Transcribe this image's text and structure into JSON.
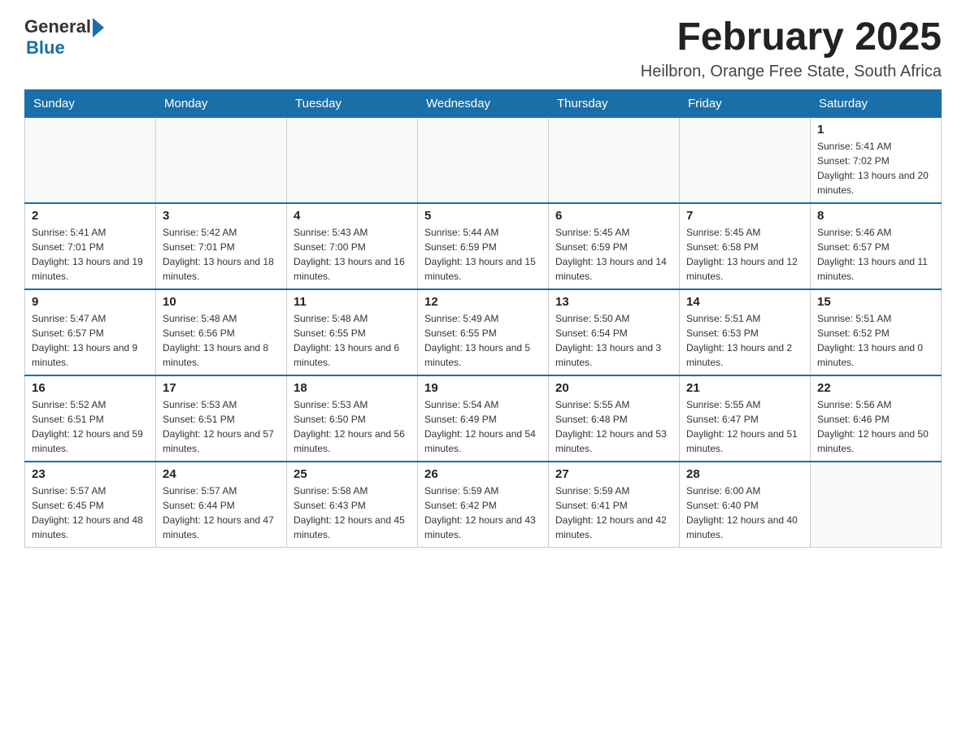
{
  "header": {
    "logo_general": "General",
    "logo_blue": "Blue",
    "month_title": "February 2025",
    "location": "Heilbron, Orange Free State, South Africa"
  },
  "weekdays": [
    "Sunday",
    "Monday",
    "Tuesday",
    "Wednesday",
    "Thursday",
    "Friday",
    "Saturday"
  ],
  "weeks": [
    [
      {
        "day": "",
        "sunrise": "",
        "sunset": "",
        "daylight": "",
        "empty": true
      },
      {
        "day": "",
        "sunrise": "",
        "sunset": "",
        "daylight": "",
        "empty": true
      },
      {
        "day": "",
        "sunrise": "",
        "sunset": "",
        "daylight": "",
        "empty": true
      },
      {
        "day": "",
        "sunrise": "",
        "sunset": "",
        "daylight": "",
        "empty": true
      },
      {
        "day": "",
        "sunrise": "",
        "sunset": "",
        "daylight": "",
        "empty": true
      },
      {
        "day": "",
        "sunrise": "",
        "sunset": "",
        "daylight": "",
        "empty": true
      },
      {
        "day": "1",
        "sunrise": "Sunrise: 5:41 AM",
        "sunset": "Sunset: 7:02 PM",
        "daylight": "Daylight: 13 hours and 20 minutes.",
        "empty": false
      }
    ],
    [
      {
        "day": "2",
        "sunrise": "Sunrise: 5:41 AM",
        "sunset": "Sunset: 7:01 PM",
        "daylight": "Daylight: 13 hours and 19 minutes.",
        "empty": false
      },
      {
        "day": "3",
        "sunrise": "Sunrise: 5:42 AM",
        "sunset": "Sunset: 7:01 PM",
        "daylight": "Daylight: 13 hours and 18 minutes.",
        "empty": false
      },
      {
        "day": "4",
        "sunrise": "Sunrise: 5:43 AM",
        "sunset": "Sunset: 7:00 PM",
        "daylight": "Daylight: 13 hours and 16 minutes.",
        "empty": false
      },
      {
        "day": "5",
        "sunrise": "Sunrise: 5:44 AM",
        "sunset": "Sunset: 6:59 PM",
        "daylight": "Daylight: 13 hours and 15 minutes.",
        "empty": false
      },
      {
        "day": "6",
        "sunrise": "Sunrise: 5:45 AM",
        "sunset": "Sunset: 6:59 PM",
        "daylight": "Daylight: 13 hours and 14 minutes.",
        "empty": false
      },
      {
        "day": "7",
        "sunrise": "Sunrise: 5:45 AM",
        "sunset": "Sunset: 6:58 PM",
        "daylight": "Daylight: 13 hours and 12 minutes.",
        "empty": false
      },
      {
        "day": "8",
        "sunrise": "Sunrise: 5:46 AM",
        "sunset": "Sunset: 6:57 PM",
        "daylight": "Daylight: 13 hours and 11 minutes.",
        "empty": false
      }
    ],
    [
      {
        "day": "9",
        "sunrise": "Sunrise: 5:47 AM",
        "sunset": "Sunset: 6:57 PM",
        "daylight": "Daylight: 13 hours and 9 minutes.",
        "empty": false
      },
      {
        "day": "10",
        "sunrise": "Sunrise: 5:48 AM",
        "sunset": "Sunset: 6:56 PM",
        "daylight": "Daylight: 13 hours and 8 minutes.",
        "empty": false
      },
      {
        "day": "11",
        "sunrise": "Sunrise: 5:48 AM",
        "sunset": "Sunset: 6:55 PM",
        "daylight": "Daylight: 13 hours and 6 minutes.",
        "empty": false
      },
      {
        "day": "12",
        "sunrise": "Sunrise: 5:49 AM",
        "sunset": "Sunset: 6:55 PM",
        "daylight": "Daylight: 13 hours and 5 minutes.",
        "empty": false
      },
      {
        "day": "13",
        "sunrise": "Sunrise: 5:50 AM",
        "sunset": "Sunset: 6:54 PM",
        "daylight": "Daylight: 13 hours and 3 minutes.",
        "empty": false
      },
      {
        "day": "14",
        "sunrise": "Sunrise: 5:51 AM",
        "sunset": "Sunset: 6:53 PM",
        "daylight": "Daylight: 13 hours and 2 minutes.",
        "empty": false
      },
      {
        "day": "15",
        "sunrise": "Sunrise: 5:51 AM",
        "sunset": "Sunset: 6:52 PM",
        "daylight": "Daylight: 13 hours and 0 minutes.",
        "empty": false
      }
    ],
    [
      {
        "day": "16",
        "sunrise": "Sunrise: 5:52 AM",
        "sunset": "Sunset: 6:51 PM",
        "daylight": "Daylight: 12 hours and 59 minutes.",
        "empty": false
      },
      {
        "day": "17",
        "sunrise": "Sunrise: 5:53 AM",
        "sunset": "Sunset: 6:51 PM",
        "daylight": "Daylight: 12 hours and 57 minutes.",
        "empty": false
      },
      {
        "day": "18",
        "sunrise": "Sunrise: 5:53 AM",
        "sunset": "Sunset: 6:50 PM",
        "daylight": "Daylight: 12 hours and 56 minutes.",
        "empty": false
      },
      {
        "day": "19",
        "sunrise": "Sunrise: 5:54 AM",
        "sunset": "Sunset: 6:49 PM",
        "daylight": "Daylight: 12 hours and 54 minutes.",
        "empty": false
      },
      {
        "day": "20",
        "sunrise": "Sunrise: 5:55 AM",
        "sunset": "Sunset: 6:48 PM",
        "daylight": "Daylight: 12 hours and 53 minutes.",
        "empty": false
      },
      {
        "day": "21",
        "sunrise": "Sunrise: 5:55 AM",
        "sunset": "Sunset: 6:47 PM",
        "daylight": "Daylight: 12 hours and 51 minutes.",
        "empty": false
      },
      {
        "day": "22",
        "sunrise": "Sunrise: 5:56 AM",
        "sunset": "Sunset: 6:46 PM",
        "daylight": "Daylight: 12 hours and 50 minutes.",
        "empty": false
      }
    ],
    [
      {
        "day": "23",
        "sunrise": "Sunrise: 5:57 AM",
        "sunset": "Sunset: 6:45 PM",
        "daylight": "Daylight: 12 hours and 48 minutes.",
        "empty": false
      },
      {
        "day": "24",
        "sunrise": "Sunrise: 5:57 AM",
        "sunset": "Sunset: 6:44 PM",
        "daylight": "Daylight: 12 hours and 47 minutes.",
        "empty": false
      },
      {
        "day": "25",
        "sunrise": "Sunrise: 5:58 AM",
        "sunset": "Sunset: 6:43 PM",
        "daylight": "Daylight: 12 hours and 45 minutes.",
        "empty": false
      },
      {
        "day": "26",
        "sunrise": "Sunrise: 5:59 AM",
        "sunset": "Sunset: 6:42 PM",
        "daylight": "Daylight: 12 hours and 43 minutes.",
        "empty": false
      },
      {
        "day": "27",
        "sunrise": "Sunrise: 5:59 AM",
        "sunset": "Sunset: 6:41 PM",
        "daylight": "Daylight: 12 hours and 42 minutes.",
        "empty": false
      },
      {
        "day": "28",
        "sunrise": "Sunrise: 6:00 AM",
        "sunset": "Sunset: 6:40 PM",
        "daylight": "Daylight: 12 hours and 40 minutes.",
        "empty": false
      },
      {
        "day": "",
        "sunrise": "",
        "sunset": "",
        "daylight": "",
        "empty": true
      }
    ]
  ]
}
